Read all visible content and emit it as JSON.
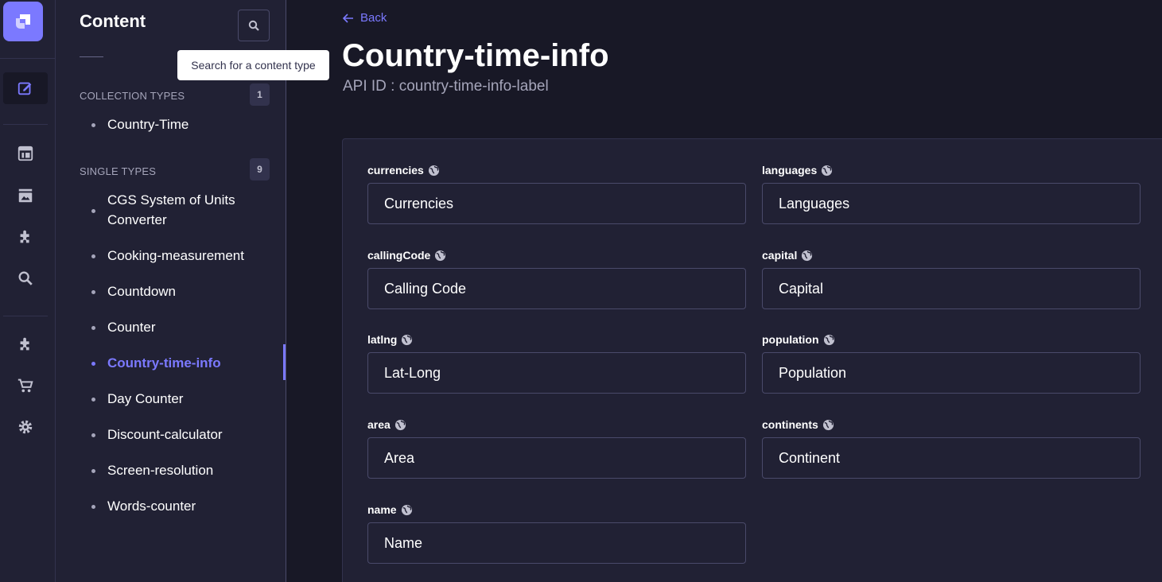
{
  "sidebar": {
    "title": "Content",
    "search_tooltip": "Search for a content type",
    "collection_types": {
      "label": "COLLECTION TYPES",
      "count": "1",
      "items": [
        "Country-Time"
      ]
    },
    "single_types": {
      "label": "SINGLE TYPES",
      "count": "9",
      "items": [
        "CGS System of Units Converter",
        "Cooking-measurement",
        "Countdown",
        "Counter",
        "Country-time-info",
        "Day Counter",
        "Discount-calculator",
        "Screen-resolution",
        "Words-counter"
      ],
      "active": "Country-time-info"
    }
  },
  "header": {
    "back_label": "Back",
    "title": "Country-time-info",
    "api_id": "API ID : country-time-info-label"
  },
  "fields": [
    {
      "name": "currencies",
      "value": "Currencies"
    },
    {
      "name": "languages",
      "value": "Languages"
    },
    {
      "name": "callingCode",
      "value": "Calling Code"
    },
    {
      "name": "capital",
      "value": "Capital"
    },
    {
      "name": "latlng",
      "value": "Lat-Long"
    },
    {
      "name": "population",
      "value": "Population"
    },
    {
      "name": "area",
      "value": "Area"
    },
    {
      "name": "continents",
      "value": "Continent"
    },
    {
      "name": "name",
      "value": "Name"
    }
  ],
  "rail_icons": [
    "logo-icon",
    "content-manager-icon",
    "layout-icon",
    "media-library-icon",
    "plugin-icon",
    "search-icon",
    "puzzle-icon",
    "marketplace-cart-icon",
    "settings-gear-icon"
  ],
  "colors": {
    "accent": "#7b79ff",
    "background": "#181826",
    "panel": "#212134",
    "border": "#4a4a6a"
  }
}
